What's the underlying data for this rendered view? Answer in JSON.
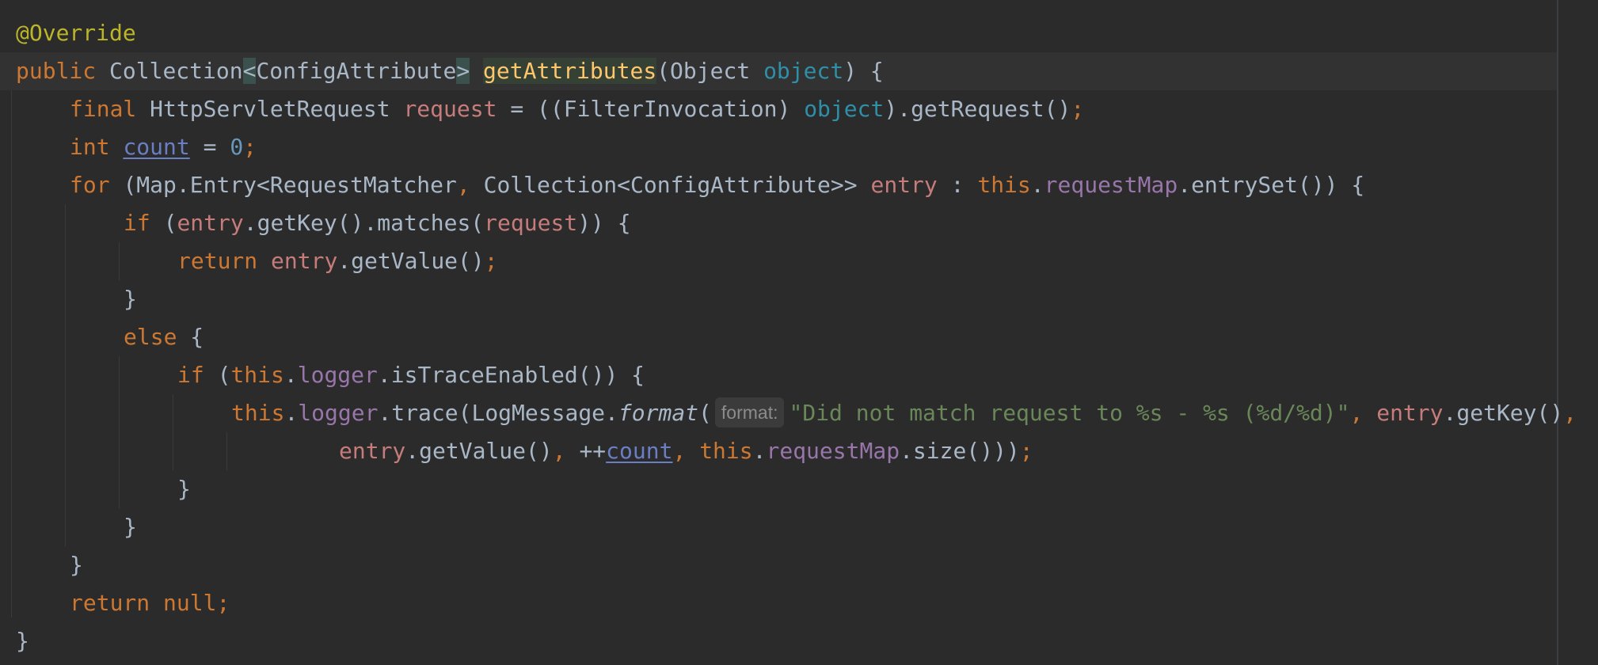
{
  "editor": {
    "lines": [
      {
        "indent": 0,
        "tokens": [
          {
            "t": "@Override",
            "c": "ann"
          }
        ]
      },
      {
        "indent": 0,
        "tokens": [
          {
            "t": "public ",
            "c": "kw"
          },
          {
            "t": "Collection",
            "c": "p"
          },
          {
            "t": "<",
            "c": "p hl"
          },
          {
            "t": "ConfigAttribute",
            "c": "p"
          },
          {
            "t": ">",
            "c": "p hl"
          },
          {
            "t": " ",
            "c": "p"
          },
          {
            "t": "getAttributes",
            "c": "fn hl2"
          },
          {
            "t": "(Object ",
            "c": "p"
          },
          {
            "t": "object",
            "c": "param"
          },
          {
            "t": ") {",
            "c": "p"
          }
        ]
      },
      {
        "indent": 1,
        "tokens": [
          {
            "t": "final ",
            "c": "kw"
          },
          {
            "t": "HttpServletRequest ",
            "c": "p"
          },
          {
            "t": "request",
            "c": "loc"
          },
          {
            "t": " = ((FilterInvocation) ",
            "c": "p"
          },
          {
            "t": "object",
            "c": "param"
          },
          {
            "t": ").getRequest()",
            "c": "p"
          },
          {
            "t": ";",
            "c": "kw"
          }
        ]
      },
      {
        "indent": 1,
        "tokens": [
          {
            "t": "int ",
            "c": "kw"
          },
          {
            "t": "count",
            "c": "uvar"
          },
          {
            "t": " = ",
            "c": "p"
          },
          {
            "t": "0",
            "c": "num"
          },
          {
            "t": ";",
            "c": "kw"
          }
        ]
      },
      {
        "indent": 1,
        "tokens": [
          {
            "t": "for ",
            "c": "kw"
          },
          {
            "t": "(Map.Entry<RequestMatcher",
            "c": "p"
          },
          {
            "t": ", ",
            "c": "kw"
          },
          {
            "t": "Collection<ConfigAttribute>> ",
            "c": "p"
          },
          {
            "t": "entry",
            "c": "loc"
          },
          {
            "t": " : ",
            "c": "p"
          },
          {
            "t": "this",
            "c": "kw"
          },
          {
            "t": ".",
            "c": "p"
          },
          {
            "t": "requestMap",
            "c": "fld"
          },
          {
            "t": ".entrySet()) {",
            "c": "p"
          }
        ]
      },
      {
        "indent": 2,
        "tokens": [
          {
            "t": "if ",
            "c": "kw"
          },
          {
            "t": "(",
            "c": "p"
          },
          {
            "t": "entry",
            "c": "loc"
          },
          {
            "t": ".getKey().matches(",
            "c": "p"
          },
          {
            "t": "request",
            "c": "loc"
          },
          {
            "t": ")) {",
            "c": "p"
          }
        ]
      },
      {
        "indent": 3,
        "tokens": [
          {
            "t": "return ",
            "c": "kw"
          },
          {
            "t": "entry",
            "c": "loc"
          },
          {
            "t": ".getValue()",
            "c": "p"
          },
          {
            "t": ";",
            "c": "kw"
          }
        ]
      },
      {
        "indent": 2,
        "tokens": [
          {
            "t": "}",
            "c": "p"
          }
        ]
      },
      {
        "indent": 2,
        "tokens": [
          {
            "t": "else ",
            "c": "kw"
          },
          {
            "t": "{",
            "c": "p"
          }
        ]
      },
      {
        "indent": 3,
        "tokens": [
          {
            "t": "if ",
            "c": "kw"
          },
          {
            "t": "(",
            "c": "p"
          },
          {
            "t": "this",
            "c": "kw"
          },
          {
            "t": ".",
            "c": "p"
          },
          {
            "t": "logger",
            "c": "fld"
          },
          {
            "t": ".isTraceEnabled()) {",
            "c": "p"
          }
        ]
      },
      {
        "indent": 4,
        "tokens": [
          {
            "t": "this",
            "c": "kw"
          },
          {
            "t": ".",
            "c": "p"
          },
          {
            "t": "logger",
            "c": "fld"
          },
          {
            "t": ".trace(LogMessage.",
            "c": "p"
          },
          {
            "t": "format",
            "c": "sm"
          },
          {
            "t": "(",
            "c": "p"
          },
          {
            "t": "format:",
            "c": "hint"
          },
          {
            "t": "\"Did not match request to %s - %s (%d/%d)\"",
            "c": "str"
          },
          {
            "t": ", ",
            "c": "kw"
          },
          {
            "t": "entry",
            "c": "loc"
          },
          {
            "t": ".getKey()",
            "c": "p"
          },
          {
            "t": ",",
            "c": "kw"
          }
        ]
      },
      {
        "indent": 6,
        "tokens": [
          {
            "t": "entry",
            "c": "loc"
          },
          {
            "t": ".getValue()",
            "c": "p"
          },
          {
            "t": ", ",
            "c": "kw"
          },
          {
            "t": "++",
            "c": "p"
          },
          {
            "t": "count",
            "c": "uvar"
          },
          {
            "t": ", ",
            "c": "kw"
          },
          {
            "t": "this",
            "c": "kw"
          },
          {
            "t": ".",
            "c": "p"
          },
          {
            "t": "requestMap",
            "c": "fld"
          },
          {
            "t": ".size()))",
            "c": "p"
          },
          {
            "t": ";",
            "c": "kw"
          }
        ]
      },
      {
        "indent": 3,
        "tokens": [
          {
            "t": "}",
            "c": "p"
          }
        ]
      },
      {
        "indent": 2,
        "tokens": [
          {
            "t": "}",
            "c": "p"
          }
        ]
      },
      {
        "indent": 1,
        "tokens": [
          {
            "t": "}",
            "c": "p"
          }
        ]
      },
      {
        "indent": 1,
        "tokens": [
          {
            "t": "return null",
            "c": "kw"
          },
          {
            "t": ";",
            "c": "kw"
          }
        ]
      },
      {
        "indent": 0,
        "tokens": [
          {
            "t": "}",
            "c": "p"
          }
        ]
      }
    ]
  }
}
